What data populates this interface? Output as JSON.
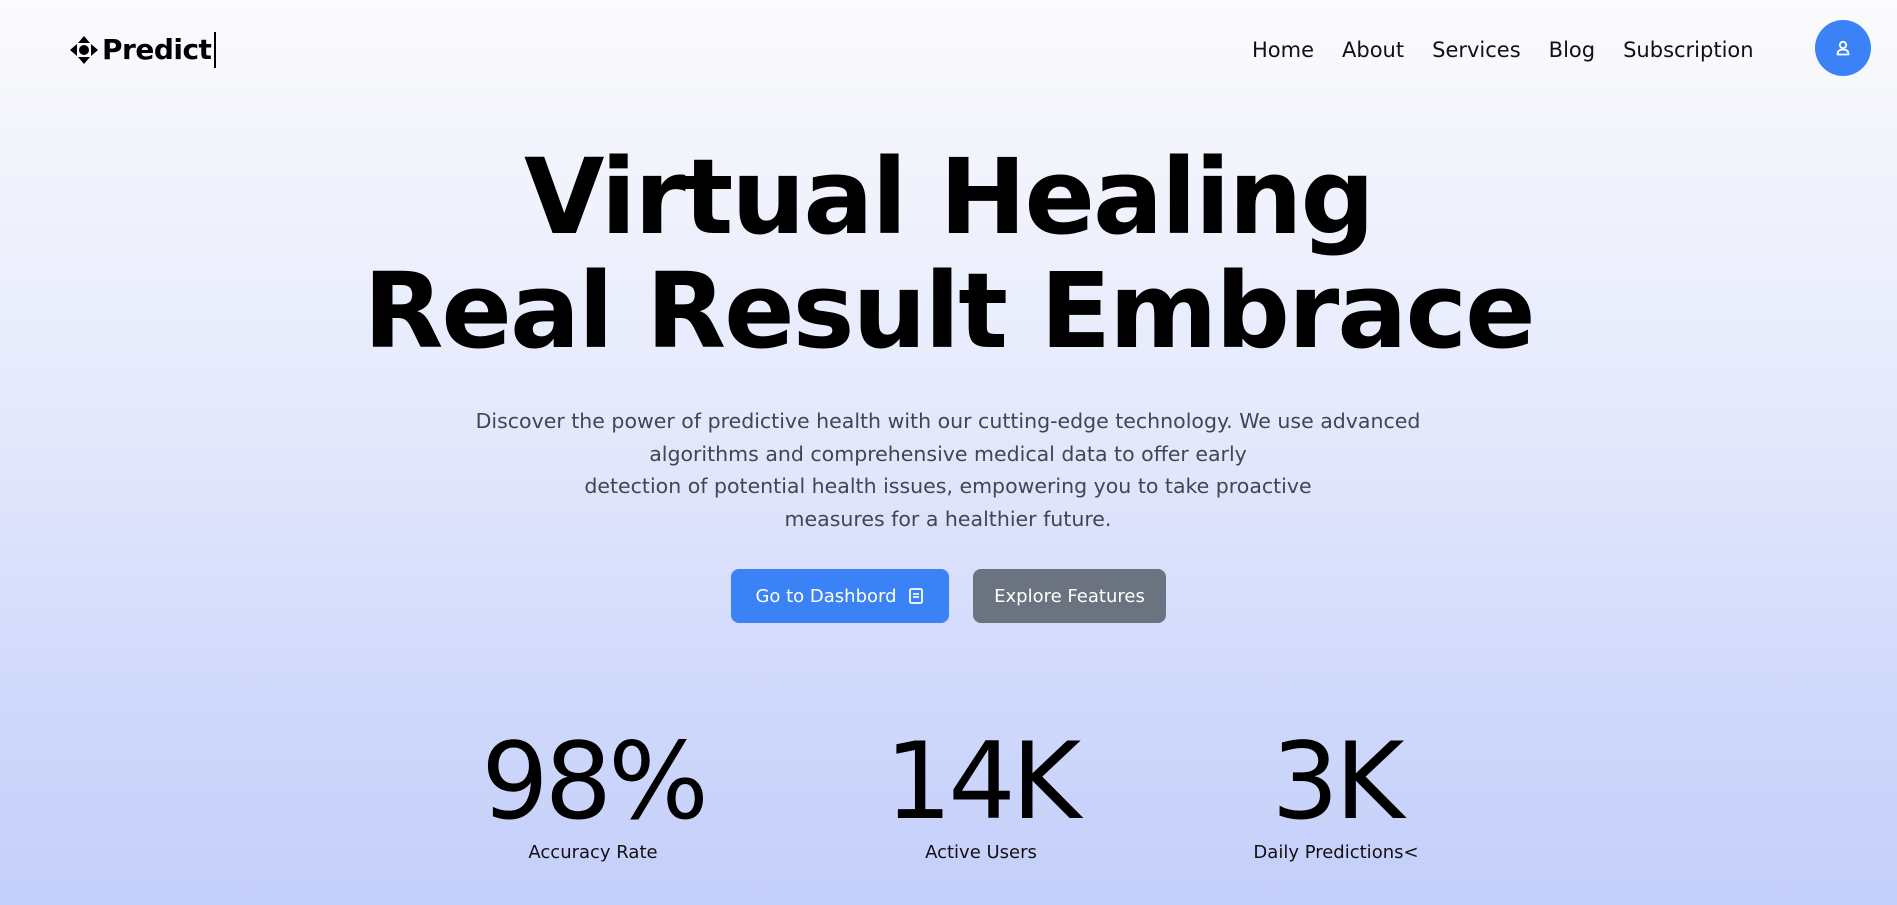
{
  "brand": {
    "name": "Predict",
    "logo_icon": "diamond-arrows-icon"
  },
  "nav": {
    "items": [
      {
        "label": "Home"
      },
      {
        "label": "About"
      },
      {
        "label": "Services"
      },
      {
        "label": "Blog"
      },
      {
        "label": "Subscription"
      }
    ],
    "profile_icon": "user-icon"
  },
  "hero": {
    "title_line1": "Virtual Healing",
    "title_line2": "Real Result Embrace",
    "description_lines": [
      "Discover the power of predictive health with our cutting-edge technology. We use advanced",
      "algorithms and comprehensive medical data to offer early",
      "detection of potential health issues, empowering you to take proactive",
      "measures for a healthier future."
    ],
    "primary_button": {
      "label": "Go to Dashbord",
      "icon": "document-icon"
    },
    "secondary_button": {
      "label": "Explore Features"
    }
  },
  "stats": [
    {
      "value": "98%",
      "label": "Accuracy Rate"
    },
    {
      "value": "14K",
      "label": "Active Users"
    },
    {
      "value": "3K",
      "label": "Daily Predictions<"
    }
  ],
  "colors": {
    "accent": "#3b82f6",
    "secondary_button": "#6b7280",
    "background_top": "#fbfbfd",
    "background_bottom": "#c4cffa"
  }
}
